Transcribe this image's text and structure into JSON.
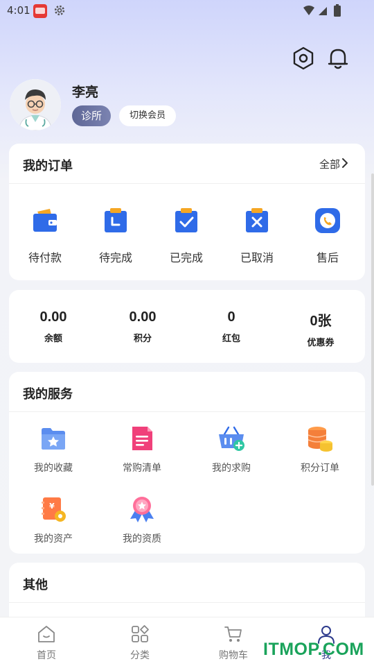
{
  "status_bar": {
    "time": "4:01"
  },
  "profile": {
    "name": "李亮",
    "role_badge": "诊所",
    "switch_label": "切换会员"
  },
  "orders": {
    "title": "我的订单",
    "all_label": "全部",
    "items": [
      {
        "label": "待付款",
        "icon": "wallet-icon"
      },
      {
        "label": "待完成",
        "icon": "clipboard-pending-icon"
      },
      {
        "label": "已完成",
        "icon": "clipboard-check-icon"
      },
      {
        "label": "已取消",
        "icon": "clipboard-cancel-icon"
      },
      {
        "label": "售后",
        "icon": "phone-service-icon"
      }
    ]
  },
  "assets": [
    {
      "value": "0.00",
      "label": "余额"
    },
    {
      "value": "0.00",
      "label": "积分"
    },
    {
      "value": "0",
      "label": "红包"
    },
    {
      "value": "0张",
      "label": "优惠券"
    }
  ],
  "services": {
    "title": "我的服务",
    "items": [
      {
        "label": "我的收藏",
        "icon": "favorite-folder-icon"
      },
      {
        "label": "常购清单",
        "icon": "list-document-icon"
      },
      {
        "label": "我的求购",
        "icon": "basket-add-icon"
      },
      {
        "label": "积分订单",
        "icon": "coins-icon"
      },
      {
        "label": "我的资产",
        "icon": "assets-icon"
      },
      {
        "label": "我的资质",
        "icon": "certificate-badge-icon"
      }
    ]
  },
  "others": {
    "title": "其他"
  },
  "tabbar": [
    {
      "label": "首页",
      "icon": "home-icon"
    },
    {
      "label": "分类",
      "icon": "category-grid-icon"
    },
    {
      "label": "购物车",
      "icon": "cart-icon"
    },
    {
      "label": "我",
      "icon": "user-icon"
    }
  ],
  "watermark": "ITMOP.COM",
  "colors": {
    "accent": "#2d3a8c",
    "order_blue": "#2f6be8",
    "order_orange": "#f5a623"
  }
}
